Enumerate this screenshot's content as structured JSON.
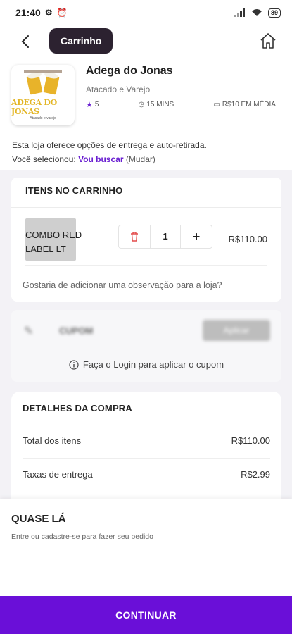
{
  "status_bar": {
    "time": "21:40",
    "battery": "89"
  },
  "header": {
    "title": "Carrinho"
  },
  "store": {
    "logo_text": "ADEGA DO JONAS",
    "logo_sub": "Atacado e varejo",
    "name": "Adega do Jonas",
    "type": "Atacado e Varejo",
    "rating": "5",
    "time": "15 MINS",
    "average": "R$10 EM MÉDIA"
  },
  "delivery": {
    "info": "Esta loja oferece opções de entrega e auto-retirada.",
    "selected_prefix": "Você selecionou:",
    "selected_value": "Vou buscar",
    "change": "(Mudar)"
  },
  "cart": {
    "title": "ITENS NO CARRINHO",
    "items": [
      {
        "name": "COMBO RED LABEL LT",
        "quantity": "1",
        "price": "R$110.00"
      }
    ],
    "observation": "Gostaria de adicionar uma observação para a loja?"
  },
  "coupon": {
    "placeholder": "CUPOM",
    "apply": "Aplicar",
    "login_hint": "Faça o Login para aplicar o cupom"
  },
  "details": {
    "title": "DETALHES DA COMPRA",
    "rows": [
      {
        "label": "Total dos itens",
        "value": "R$110.00"
      },
      {
        "label": "Taxas de entrega",
        "value": "R$2.99"
      }
    ]
  },
  "sheet": {
    "title": "QUASE LÁ",
    "subtitle": "Entre ou cadastre-se para fazer seu pedido",
    "cta": "CONTINUAR"
  },
  "colors": {
    "accent": "#6a0fd8",
    "pill": "#2c2230"
  }
}
